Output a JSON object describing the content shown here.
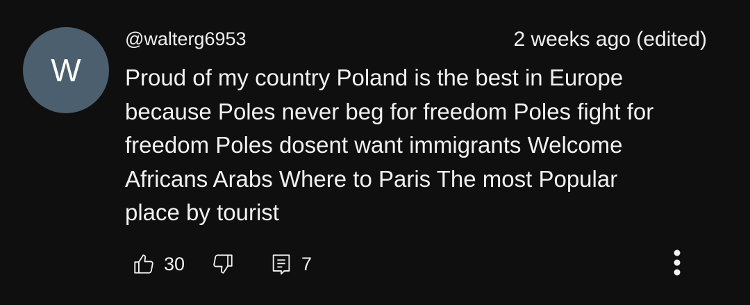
{
  "comment": {
    "avatar_letter": "W",
    "avatar_color": "#4c5f6e",
    "author": "@walterg6953",
    "timestamp": "2 weeks ago (edited)",
    "text": "Proud of my country Poland is the best in Europe\nbecause Poles never beg for freedom Poles fight for\nfreedom Poles dosent want immigrants  Welcome\nAfricans Arabs Where to Paris The most Popular\nplace by tourist",
    "actions": {
      "like_icon": "thumbs-up-icon",
      "like_count": "30",
      "dislike_icon": "thumbs-down-icon",
      "reply_icon": "reply-icon",
      "reply_count": "7",
      "more_icon": "more-vertical-icon"
    }
  }
}
